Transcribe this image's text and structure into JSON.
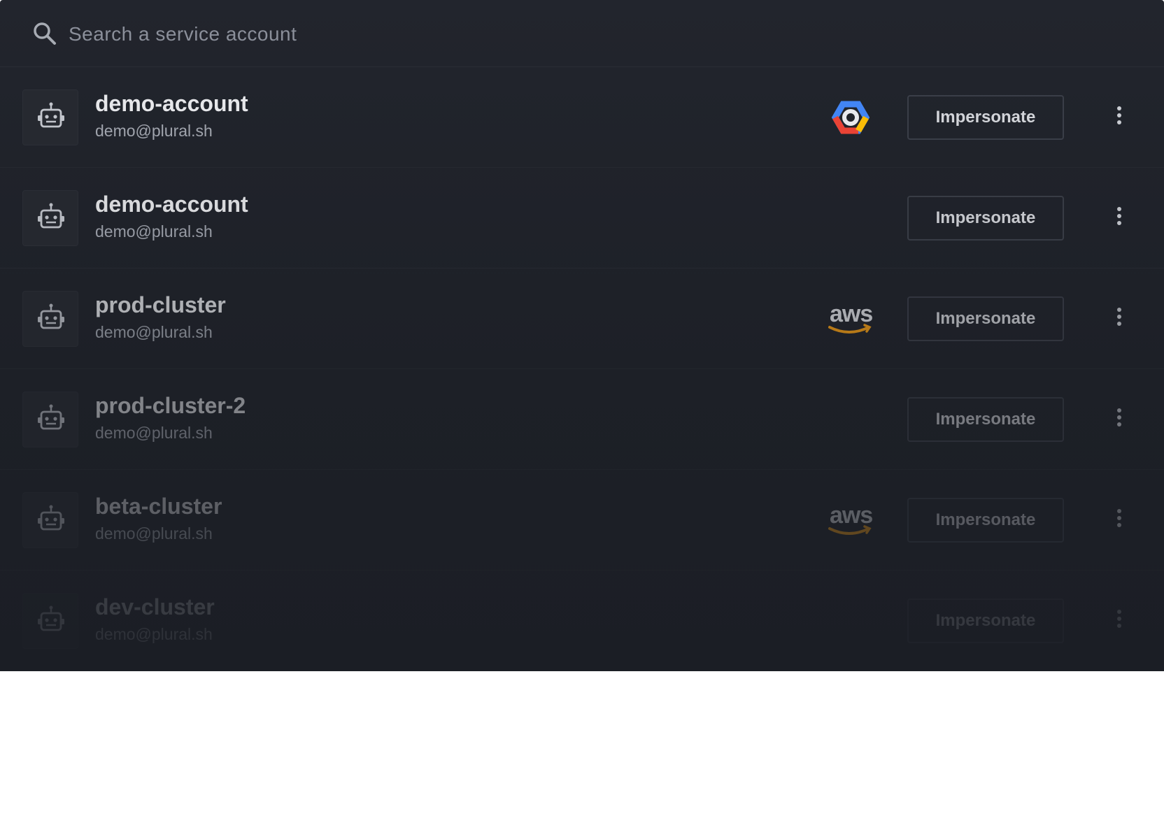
{
  "search": {
    "placeholder": "Search a service account",
    "icon": "search-icon"
  },
  "accounts": [
    {
      "name": "demo-account",
      "email": "demo@plural.sh",
      "provider": "gcp",
      "action": "Impersonate"
    },
    {
      "name": "demo-account",
      "email": "demo@plural.sh",
      "provider": "",
      "action": "Impersonate"
    },
    {
      "name": "prod-cluster",
      "email": "demo@plural.sh",
      "provider": "aws",
      "action": "Impersonate"
    },
    {
      "name": "prod-cluster-2",
      "email": "demo@plural.sh",
      "provider": "",
      "action": "Impersonate"
    },
    {
      "name": "beta-cluster",
      "email": "demo@plural.sh",
      "provider": "aws",
      "action": "Impersonate"
    },
    {
      "name": "dev-cluster",
      "email": "demo@plural.sh",
      "provider": "",
      "action": "Impersonate"
    }
  ],
  "provider_logos": {
    "aws_text": "aws"
  },
  "colors": {
    "background": "#1f2229",
    "text_primary": "#e6e7ea",
    "text_secondary": "#a0a4ad",
    "border": "#3a3e48",
    "aws_orange": "#f39c12"
  }
}
